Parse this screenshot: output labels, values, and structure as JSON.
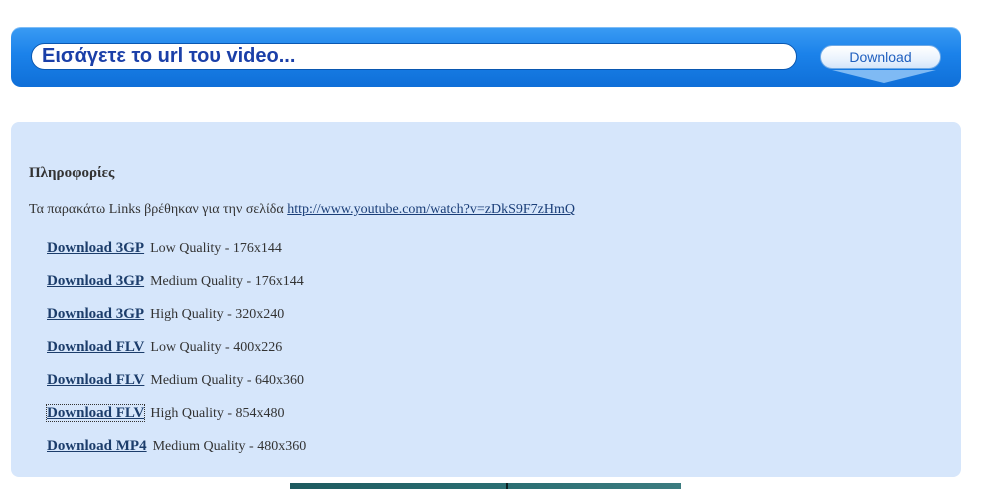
{
  "search": {
    "placeholder": "Εισάγετε το url του video...",
    "value": ""
  },
  "download_button": {
    "label": "Download"
  },
  "info": {
    "heading": "Πληροφορίες",
    "intro_text": "Τα παρακάτω Links βρέθηκαν για την σελίδα ",
    "url": "http://www.youtube.com/watch?v=zDkS9F7zHmQ"
  },
  "links": [
    {
      "label": "Download 3GP",
      "description": "Low Quality - 176x144"
    },
    {
      "label": "Download 3GP",
      "description": "Medium Quality - 176x144"
    },
    {
      "label": "Download 3GP",
      "description": "High Quality - 320x240"
    },
    {
      "label": "Download FLV",
      "description": "Low Quality - 400x226"
    },
    {
      "label": "Download FLV",
      "description": "Medium Quality - 640x360"
    },
    {
      "label": "Download FLV",
      "description": "High Quality - 854x480"
    },
    {
      "label": "Download MP4",
      "description": "Medium Quality - 480x360"
    }
  ],
  "colors": {
    "bar_blue": "#1b82ea",
    "panel_bg": "#d6e6fb",
    "link": "#1c3d6b"
  }
}
